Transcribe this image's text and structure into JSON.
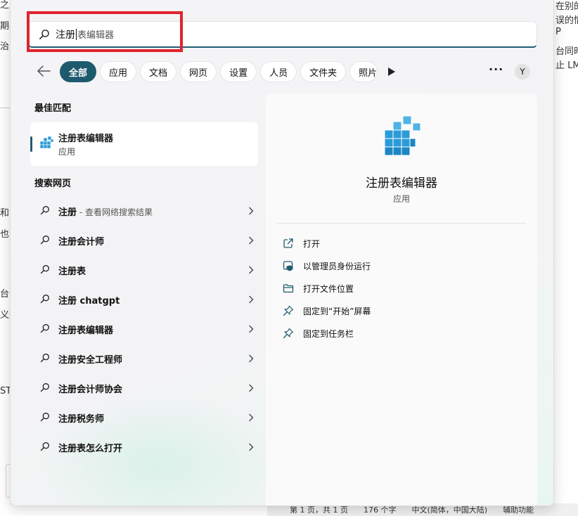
{
  "background": {
    "left_fragments": [
      "之夕",
      "期手",
      "治",
      "和",
      "也",
      "台同",
      "义数",
      "ST"
    ],
    "right_fragments": [
      "在别的",
      "误的情",
      "P",
      "台同时",
      "止 LM"
    ],
    "status_bar": [
      "第 1 页，共 1 页",
      "176 个字",
      "中文(简体，中国大陆)",
      "辅助功能"
    ]
  },
  "search": {
    "typed": "注册",
    "suggestion": "表编辑器"
  },
  "filters": {
    "chips": [
      {
        "label": "全部",
        "active": true
      },
      {
        "label": "应用",
        "active": false
      },
      {
        "label": "文档",
        "active": false
      },
      {
        "label": "网页",
        "active": false
      },
      {
        "label": "设置",
        "active": false
      },
      {
        "label": "人员",
        "active": false
      },
      {
        "label": "文件夹",
        "active": false
      },
      {
        "label": "照片",
        "active": false
      }
    ],
    "more": "···",
    "avatar": "Y"
  },
  "best_match": {
    "heading": "最佳匹配",
    "name": "注册表编辑器",
    "type": "应用"
  },
  "web_search": {
    "heading": "搜索网页",
    "items": [
      {
        "label": "注册",
        "sub": " - 查看网络搜索结果"
      },
      {
        "label": "注册会计师",
        "sub": ""
      },
      {
        "label": "注册表",
        "sub": ""
      },
      {
        "label": "注册 chatgpt",
        "sub": ""
      },
      {
        "label": "注册表编辑器",
        "sub": ""
      },
      {
        "label": "注册安全工程师",
        "sub": ""
      },
      {
        "label": "注册会计师协会",
        "sub": ""
      },
      {
        "label": "注册税务师",
        "sub": ""
      },
      {
        "label": "注册表怎么打开",
        "sub": ""
      }
    ]
  },
  "detail": {
    "title": "注册表编辑器",
    "type": "应用",
    "actions": [
      {
        "label": "打开",
        "icon": "open-external-icon"
      },
      {
        "label": "以管理员身份运行",
        "icon": "shield-icon"
      },
      {
        "label": "打开文件位置",
        "icon": "folder-icon"
      },
      {
        "label": "固定到“开始”屏幕",
        "icon": "pin-icon"
      },
      {
        "label": "固定到任务栏",
        "icon": "pin-icon"
      }
    ]
  },
  "colors": {
    "accent": "#1e5a6d",
    "highlight": "#e0242d",
    "icon_blue": "#2b9bd8"
  }
}
